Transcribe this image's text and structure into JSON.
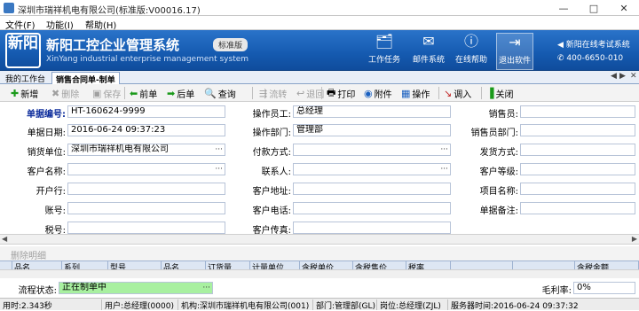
{
  "window": {
    "title": "深圳市瑞祥机电有限公司(标准版:V00016.17)",
    "minimize": "—",
    "restore": "□",
    "close": "✕"
  },
  "menu": [
    "文件(F)",
    "功能(I)",
    "帮助(H)"
  ],
  "banner": {
    "logo_text": "新阳",
    "title": "新阳工控企业管理系统",
    "edition": "标准版",
    "subtitle": "XinYang industrial enterprise management system",
    "buttons": [
      {
        "label": "工作任务",
        "icon": "folder-icon"
      },
      {
        "label": "邮件系统",
        "icon": "mail-icon"
      },
      {
        "label": "在线帮助",
        "icon": "info-icon"
      },
      {
        "label": "退出软件",
        "icon": "exit-icon"
      }
    ],
    "contact_title": "新阳在线考试系统",
    "phone": "400-6650-010"
  },
  "tabs": [
    "我的工作台",
    "销售合同单-制单"
  ],
  "toolbar": {
    "new": "新增",
    "delete": "删除",
    "save": "保存",
    "prev": "前单",
    "next": "后单",
    "query": "查询",
    "flow": "流转",
    "return": "退回",
    "print": "打印",
    "attach": "附件",
    "operate": "操作",
    "import": "调入",
    "close": "关闭"
  },
  "form": {
    "doc_no_label": "单据编号:",
    "doc_no": "HT-160624-9999",
    "date_label": "单据日期:",
    "date": "2016-06-24 09:37:23",
    "seller_label": "销货单位:",
    "seller": "深圳市瑞祥机电有限公司",
    "customer_label": "客户名称:",
    "customer": "",
    "bank_label": "开户行:",
    "bank": "",
    "account_label": "账号:",
    "account": "",
    "tax_label": "税号:",
    "tax": "",
    "operator_label": "操作员工:",
    "operator": "总经理",
    "dept_label": "操作部门:",
    "dept": "管理部",
    "pay_label": "付款方式:",
    "pay": "",
    "contact_label": "联系人:",
    "contact": "",
    "addr_label": "客户地址:",
    "addr": "",
    "phone_label": "客户电话:",
    "phone": "",
    "fax_label": "客户传真:",
    "fax": "",
    "salesman_label": "销售员:",
    "salesman": "",
    "salesdept_label": "销售员部门:",
    "salesdept": "",
    "ship_label": "发货方式:",
    "ship": "",
    "level_label": "客户等级:",
    "level": "",
    "project_label": "项目名称:",
    "project": "",
    "remark_label": "单据备注:",
    "remark": ""
  },
  "grid": {
    "delete_detail": "删除明细",
    "columns": [
      "",
      "品名",
      "系列",
      "型号",
      "品名",
      "订货量",
      "计量单位",
      "含税单价",
      "含税售价",
      "税率",
      "",
      "",
      "含税金额"
    ]
  },
  "bottom": {
    "flow_label": "流程状态:",
    "flow_status": "正在制单中",
    "margin_label": "毛利率:",
    "margin": "0%"
  },
  "status": {
    "time": "用时:2.343秒",
    "user": "用户:总经理(0000)",
    "org": "机构:深圳市瑞祥机电有限公司(001)",
    "dept": "部门:管理部(GL)",
    "post": "岗位:总经理(ZJL)",
    "server_time": "服务器时间:2016-06-24 09:37:32"
  },
  "colors": {
    "banner": "#155ab0",
    "status_green": "#a8f0a0",
    "label_blue": "#0a2a9a"
  }
}
